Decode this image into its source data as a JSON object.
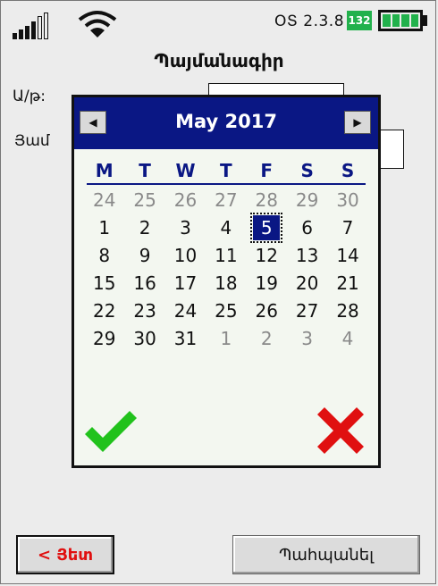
{
  "status": {
    "version": "ՕՏ 2.3.8",
    "battery_level": "132",
    "battery_bars": 4
  },
  "title": "Պայմանագիր",
  "form": {
    "row1_label": "Ա/թ:",
    "row2_label": "Յամ"
  },
  "calendar": {
    "month_label": "May 2017",
    "prev_icon": "left-arrow-icon",
    "next_icon": "right-arrow-icon",
    "weekdays": [
      "M",
      "T",
      "W",
      "T",
      "F",
      "S",
      "S"
    ],
    "weeks": [
      [
        "24",
        "25",
        "26",
        "27",
        "28",
        "29",
        "30"
      ],
      [
        "1",
        "2",
        "3",
        "4",
        "5",
        "6",
        "7"
      ],
      [
        "8",
        "9",
        "10",
        "11",
        "12",
        "13",
        "14"
      ],
      [
        "15",
        "16",
        "17",
        "18",
        "19",
        "20",
        "21"
      ],
      [
        "22",
        "23",
        "24",
        "25",
        "26",
        "27",
        "28"
      ],
      [
        "29",
        "30",
        "31",
        "1",
        "2",
        "3",
        "4"
      ]
    ],
    "selected": "5",
    "ok_icon": "checkmark-icon",
    "cancel_icon": "x-icon",
    "colors": {
      "header": "#0a1784",
      "ok": "#21c21c",
      "cancel": "#e01010"
    }
  },
  "buttons": {
    "back_label": "< Յետ",
    "save_label": "Պահպանել"
  }
}
